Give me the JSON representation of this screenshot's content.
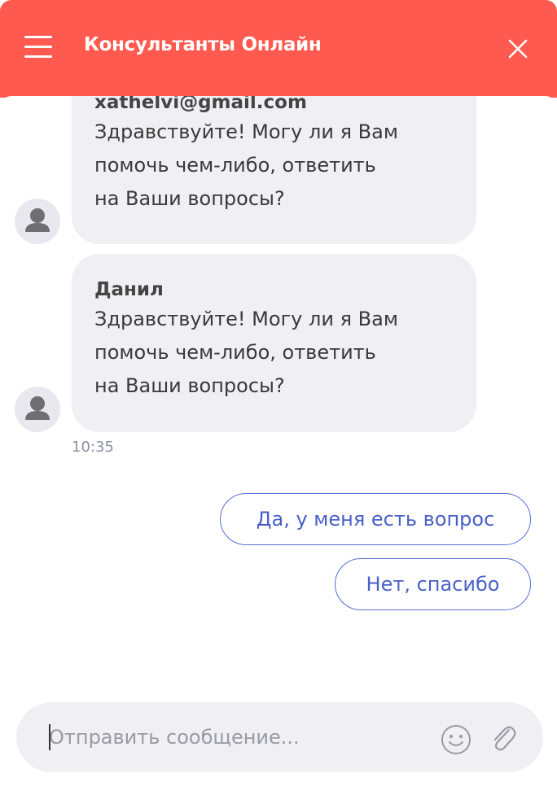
{
  "header": {
    "title": "Консультанты Онлайн",
    "menu_icon": "hamburger-menu-icon",
    "close_icon": "close-icon"
  },
  "messages": [
    {
      "sender": "xathelvi@gmail.com",
      "text": "Здравствуйте! Могу ли я Вам\nпомочь чем-либо, ответить\nна Ваши вопросы?",
      "avatar_icon": "user-avatar-icon"
    },
    {
      "sender": "Данил",
      "text": "Здравствуйте! Могу ли я Вам\nпомочь чем-либо, ответить\nна Ваши вопросы?",
      "avatar_icon": "user-avatar-icon"
    }
  ],
  "timestamp": "10:35",
  "quick_replies": [
    {
      "label": "Да, у меня есть вопрос"
    },
    {
      "label": "Нет, спасибо"
    }
  ],
  "composer": {
    "placeholder": "Отправить сообщение...",
    "value": "",
    "emoji_icon": "smiley-icon",
    "attach_icon": "paperclip-icon"
  },
  "colors": {
    "header_bg": "#ff5a4f",
    "bubble_bg": "#f0eff4",
    "quick_reply_border": "#5a6fd6",
    "quick_reply_text": "#4a5fc8",
    "timestamp": "#8a8fa3"
  }
}
